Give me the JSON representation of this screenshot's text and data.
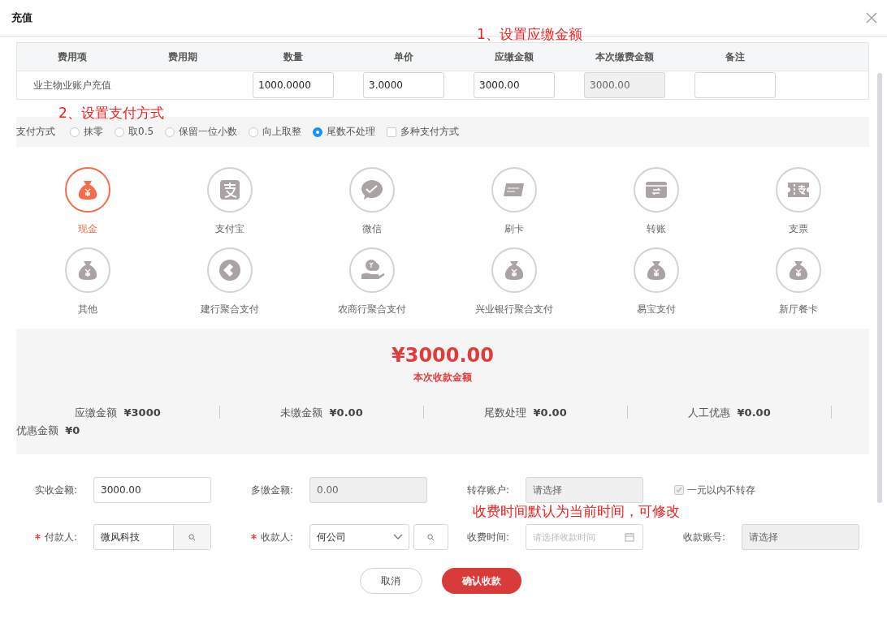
{
  "dialog": {
    "title": "充值"
  },
  "annotations": [
    {
      "text": "1、设置应缴金额"
    },
    {
      "text": "2、设置支付方式"
    },
    {
      "text": "收费时间默认为当前时间，可修改"
    }
  ],
  "table": {
    "columns": [
      "费用项",
      "费用期",
      "数量",
      "单价",
      "应缴金额",
      "本次缴费金额",
      "备注"
    ],
    "rows": [
      {
        "cells": [
          {
            "kind": "text",
            "text": "业主物业账户充值"
          },
          {
            "kind": "empty"
          },
          {
            "kind": "input",
            "value": "1000.0000"
          },
          {
            "kind": "input",
            "value": "3.0000"
          },
          {
            "kind": "input",
            "value": "3000.00"
          },
          {
            "kind": "disabled",
            "value": "3000.00"
          },
          {
            "kind": "input"
          }
        ]
      }
    ]
  },
  "payment_options": {
    "label": "支付方式",
    "options": [
      {
        "label": "抹零",
        "selected": false
      },
      {
        "label": "取0.5",
        "selected": false
      },
      {
        "label": "保留一位小数",
        "selected": false
      },
      {
        "label": "向上取整",
        "selected": false
      },
      {
        "label": "尾数不处理",
        "selected": true
      }
    ],
    "multi": {
      "label": "多种支付方式",
      "checked": false
    }
  },
  "methods": [
    {
      "label": "现金",
      "selected": true,
      "kind": "bag"
    },
    {
      "label": "支付宝",
      "selected": false,
      "kind": "alipay"
    },
    {
      "label": "微信",
      "selected": false,
      "kind": "chat"
    },
    {
      "label": "刷卡",
      "selected": false,
      "kind": "card"
    },
    {
      "label": "转账",
      "selected": false,
      "kind": "transfer"
    },
    {
      "label": "支票",
      "selected": false,
      "kind": "ticket"
    },
    {
      "label": "其他",
      "selected": false,
      "kind": "bag"
    },
    {
      "label": "建行聚合支付",
      "selected": false,
      "kind": "ccb"
    },
    {
      "label": "农商行聚合支付",
      "selected": false,
      "kind": "hand"
    },
    {
      "label": "兴业银行聚合支付",
      "selected": false,
      "kind": "bag"
    },
    {
      "label": "易宝支付",
      "selected": false,
      "kind": "bag"
    },
    {
      "label": "新厅餐卡",
      "selected": false,
      "kind": "bag"
    }
  ],
  "summary": {
    "amount": "¥3000.00",
    "amount_label": "本次收款金额",
    "items": [
      {
        "label": "应缴金额",
        "value": "¥3000"
      },
      {
        "label": "未缴金额",
        "value": "¥0.00"
      },
      {
        "label": "尾数处理",
        "value": "¥0.00"
      },
      {
        "label": "人工优惠",
        "value": "¥0.00"
      },
      {
        "label": "优惠金额",
        "value": "¥0"
      }
    ]
  },
  "form": [
    {
      "label": "实收金额:",
      "kind": "input",
      "required": false,
      "value": "3000.00"
    },
    {
      "label": "多缴金额:",
      "kind": "disabled",
      "required": false,
      "value": "0.00"
    },
    {
      "label": "转存账户:",
      "kind": "disabled",
      "required": false,
      "placeholder": "请选择"
    },
    {
      "label": "一元以内不转存",
      "kind": "checkbox",
      "checked": true
    },
    {
      "label": "付款人:",
      "kind": "search",
      "required": true,
      "value": "微风科技"
    },
    {
      "label": "收款人:",
      "kind": "select",
      "required": true,
      "value": "何公司"
    },
    {
      "label": "收费时间:",
      "kind": "date",
      "required": false,
      "placeholder": "请选择收款时间"
    },
    {
      "label": "收款账号:",
      "kind": "disabled",
      "required": false,
      "placeholder": "请选择"
    }
  ],
  "buttons": [
    {
      "label": "取消",
      "kind": "cancel"
    },
    {
      "label": "确认收款",
      "kind": "primary"
    }
  ]
}
